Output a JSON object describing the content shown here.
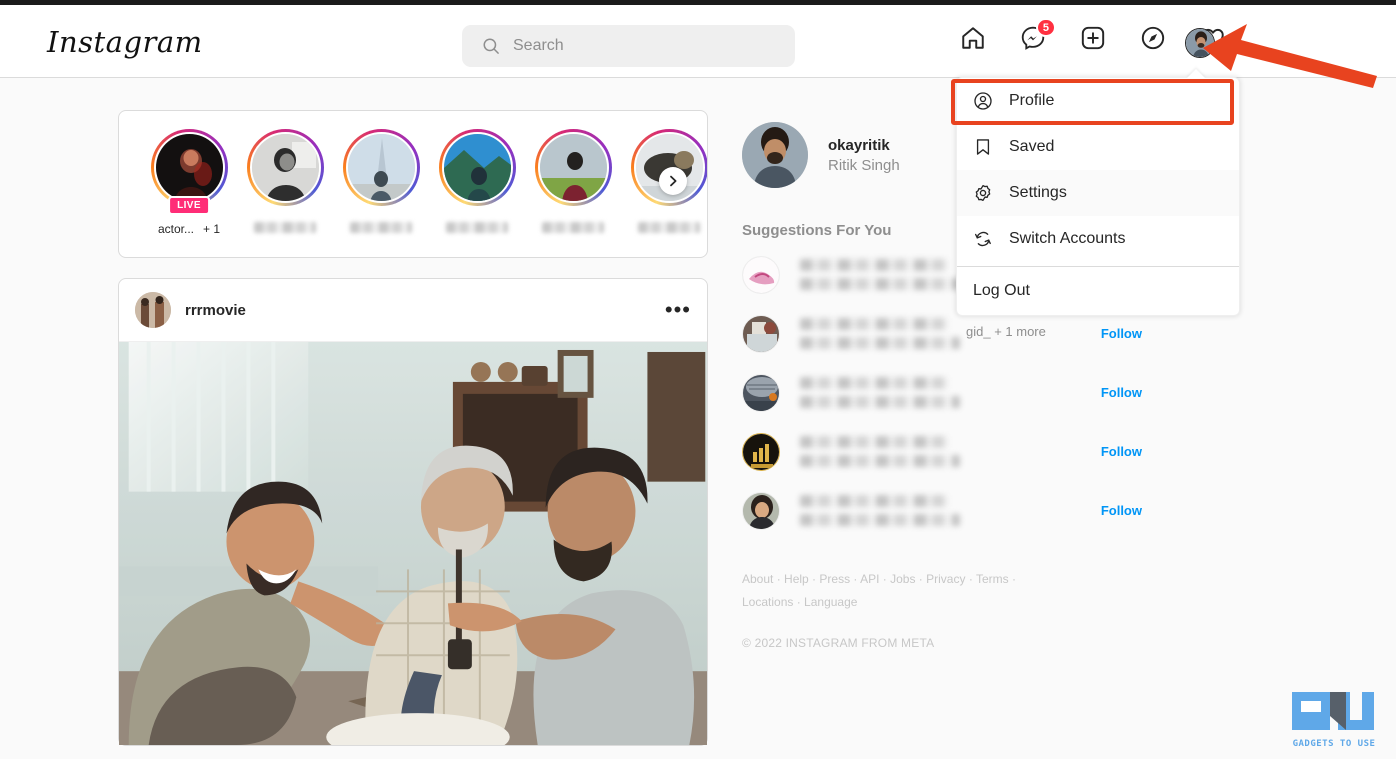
{
  "app": {
    "logo_text": "Instagram"
  },
  "search": {
    "placeholder": "Search",
    "icon": "search-icon"
  },
  "nav": {
    "home_icon": "home-icon",
    "messenger_icon": "messenger-icon",
    "messenger_badge": "5",
    "create_icon": "plus-square-icon",
    "explore_icon": "compass-icon",
    "activity_icon": "heart-icon",
    "avatar": "profile-avatar"
  },
  "dropdown": {
    "items": [
      {
        "label": "Profile",
        "icon": "person-circle-icon",
        "highlighted": true
      },
      {
        "label": "Saved",
        "icon": "bookmark-icon",
        "highlighted": false
      },
      {
        "label": "Settings",
        "icon": "gear-icon",
        "highlighted": false
      },
      {
        "label": "Switch Accounts",
        "icon": "switch-arrows-icon",
        "highlighted": false
      }
    ],
    "logout_label": "Log Out"
  },
  "annotation": {
    "highlight_color": "#e8431f",
    "arrow_color": "#e8431f"
  },
  "stories": {
    "next_icon": "chevron-right-icon",
    "items": [
      {
        "label": "actor...",
        "extra": "+ 1",
        "live": "LIVE",
        "blurred": false
      },
      {
        "label": "",
        "extra": "",
        "live": "",
        "blurred": true
      },
      {
        "label": "",
        "extra": "",
        "live": "",
        "blurred": true
      },
      {
        "label": "",
        "extra": "",
        "live": "",
        "blurred": true
      },
      {
        "label": "",
        "extra": "",
        "live": "",
        "blurred": true
      },
      {
        "label": "",
        "extra": "",
        "live": "",
        "blurred": true
      }
    ]
  },
  "post": {
    "username": "rrrmovie",
    "more_label": "•••"
  },
  "profile": {
    "username": "okayritik",
    "full_name": "Ritik Singh"
  },
  "suggestions": {
    "title": "Suggestions For You",
    "follow_label": "Follow",
    "follow_color": "#0095f6",
    "rows": [
      {
        "extra": "",
        "blurred": true
      },
      {
        "extra": "gid_ + 1 more",
        "blurred": true
      },
      {
        "extra": "",
        "blurred": true
      },
      {
        "extra": "",
        "blurred": true
      },
      {
        "extra": "",
        "blurred": true
      }
    ]
  },
  "footer": {
    "links": [
      "About",
      "Help",
      "Press",
      "API",
      "Jobs",
      "Privacy",
      "Terms",
      "Locations",
      "Language"
    ],
    "copyright": "© 2022 INSTAGRAM FROM META"
  },
  "watermark": {
    "text": "GADGETS TO USE"
  }
}
